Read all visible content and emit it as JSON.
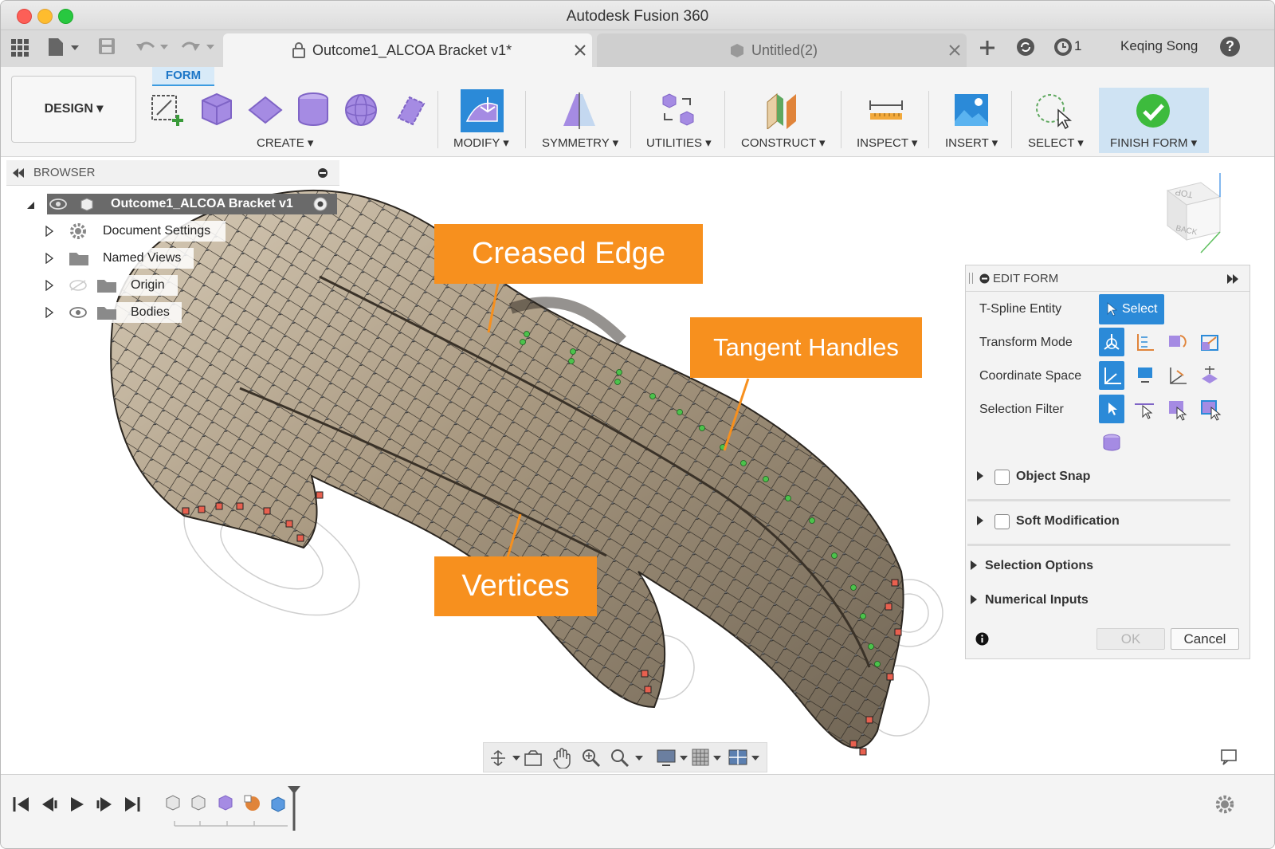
{
  "window": {
    "title": "Autodesk Fusion 360"
  },
  "tabs": [
    {
      "label": "Outcome1_ALCOA Bracket v1*",
      "active": true
    },
    {
      "label": "Untitled(2)",
      "active": false
    }
  ],
  "tabbar": {
    "job_count": "1",
    "user_name": "Keqing Song",
    "help": "?"
  },
  "toolbar": {
    "workspace": "DESIGN",
    "active_tab": "FORM",
    "groups": [
      "CREATE",
      "MODIFY",
      "SYMMETRY",
      "UTILITIES",
      "CONSTRUCT",
      "INSPECT",
      "INSERT",
      "SELECT",
      "FINISH FORM"
    ]
  },
  "browser": {
    "title": "BROWSER",
    "root": "Outcome1_ALCOA Bracket v1",
    "items": [
      "Document Settings",
      "Named Views",
      "Origin",
      "Bodies"
    ]
  },
  "viewcube": {
    "top": "TOP",
    "back": "BACK"
  },
  "callouts": {
    "creased_edge": "Creased Edge",
    "tangent_handles": "Tangent Handles",
    "vertices": "Vertices"
  },
  "edit_form": {
    "title": "EDIT FORM",
    "rows": [
      "T-Spline Entity",
      "Transform Mode",
      "Coordinate Space",
      "Selection Filter"
    ],
    "select_label": "Select",
    "object_snap": "Object Snap",
    "soft_modification": "Soft Modification",
    "selection_options": "Selection Options",
    "numerical_inputs": "Numerical Inputs",
    "ok": "OK",
    "cancel": "Cancel"
  },
  "colors": {
    "accent_blue": "#2b8ad8",
    "callout_orange": "#f7901e",
    "finish_green": "#3dbb3d",
    "form_purple": "#a58be3"
  }
}
